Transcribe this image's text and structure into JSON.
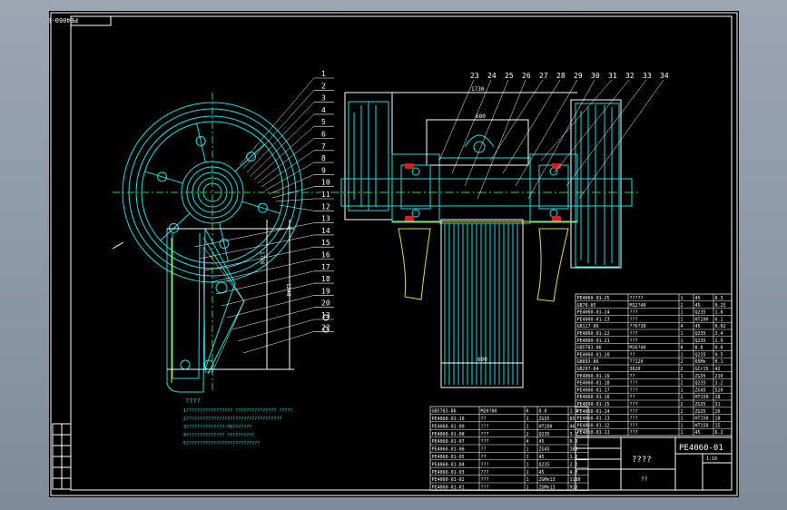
{
  "drawing": {
    "code_rotated": "PE4060-01",
    "code_main": "PE4060-01",
    "tech_title": "????",
    "tech_lines": [
      "1????????????????? ??????????????? ?????",
      "2???????????????????????????????????",
      "3??????????????~70???????",
      "4?????????????? ??????????",
      "5???????????????????????????"
    ],
    "balloons_left": [
      "1",
      "2",
      "3",
      "4",
      "5",
      "6",
      "7",
      "8",
      "9",
      "10",
      "11",
      "12",
      "13",
      "14",
      "15",
      "16",
      "17",
      "18",
      "19",
      "20",
      "13",
      "22"
    ],
    "balloons_top": [
      "23",
      "24",
      "25",
      "26",
      "27",
      "28",
      "29",
      "30",
      "31",
      "32",
      "33",
      "34"
    ],
    "dims": {
      "overall": "1730",
      "inner": "680",
      "height_a": "1726",
      "height_b": "1240",
      "bottom": "600"
    },
    "parts_right": [
      [
        "PE4060-01-25",
        "?????",
        "1",
        "45",
        "8.3"
      ],
      [
        "GB70-85",
        "M12?40",
        "2",
        "45",
        "0.25"
      ],
      [
        "PE4060-01-24",
        "???",
        "1",
        "Q235",
        "1.8"
      ],
      [
        "PE4060-01-23",
        "???",
        "1",
        "HT200",
        "6.1"
      ],
      [
        "GB117-86",
        "??6?30",
        "4",
        "45",
        "0.02"
      ],
      [
        "PE4060-01-22",
        "???",
        "1",
        "Q235",
        "3.4"
      ],
      [
        "PE4060-01-21",
        "???",
        "1",
        "Q235",
        "2.9"
      ],
      [
        "GB5783-86",
        "M16?40",
        "8",
        "8.8",
        "0.8"
      ],
      [
        "PE4060-01-20",
        "??",
        "1",
        "Q235",
        "9.5"
      ],
      [
        "GB893-86",
        "??120",
        "2",
        "65Mn",
        "0.1"
      ],
      [
        "GB297-84",
        "3620",
        "2",
        "GCr15",
        "42"
      ],
      [
        "PE4060-01-19",
        "??",
        "1",
        "ZG35",
        "210"
      ],
      [
        "PE4060-01-18",
        "???",
        "2",
        "Q235",
        "3.2"
      ],
      [
        "PE4060-01-17",
        "???",
        "1",
        "ZG45",
        "520"
      ],
      [
        "PE4060-01-16",
        "??",
        "2",
        "HT150",
        "28"
      ],
      [
        "PE4060-01-15",
        "???",
        "2",
        "ZG35",
        "31"
      ],
      [
        "PE4060-01-14",
        "???",
        "2",
        "ZG35",
        "26"
      ],
      [
        "PE4060-01-13",
        "???",
        "1",
        "HT150",
        "18"
      ],
      [
        "PE4060-01-12",
        "???",
        "1",
        "HT150",
        "15"
      ],
      [
        "PE4060-01-11",
        "???",
        "1",
        "45",
        "6.2"
      ]
    ],
    "parts_left": [
      [
        "GB5783-86",
        "M20?80",
        "6",
        "8.8",
        "1.4"
      ],
      [
        "PE4060-01-10",
        "??",
        "1",
        "ZG35",
        "85"
      ],
      [
        "PE4060-01-09",
        "???",
        "1",
        "HT200",
        "46"
      ],
      [
        "PE4060-01-08",
        "???",
        "2",
        "Q235",
        "3.1"
      ],
      [
        "PE4060-01-07",
        "???",
        "4",
        "45",
        "0.4"
      ],
      [
        "PE4060-01-06",
        "??",
        "1",
        "ZG45",
        "380"
      ],
      [
        "PE4060-01-05",
        "??",
        "1",
        "45",
        "1.2"
      ],
      [
        "PE4060-01-04",
        "???",
        "1",
        "Q235",
        "2.2"
      ],
      [
        "PE4060-01-03",
        "???",
        "1",
        "45",
        "4.8"
      ],
      [
        "PE4060-01-02",
        "???",
        "1",
        "ZGMn13",
        "1180"
      ],
      [
        "PE4060-01-01",
        "???",
        "1",
        "ZGMn13",
        "910"
      ]
    ],
    "title_block": {
      "name": "????",
      "scale": "1:10",
      "school": "??"
    }
  }
}
